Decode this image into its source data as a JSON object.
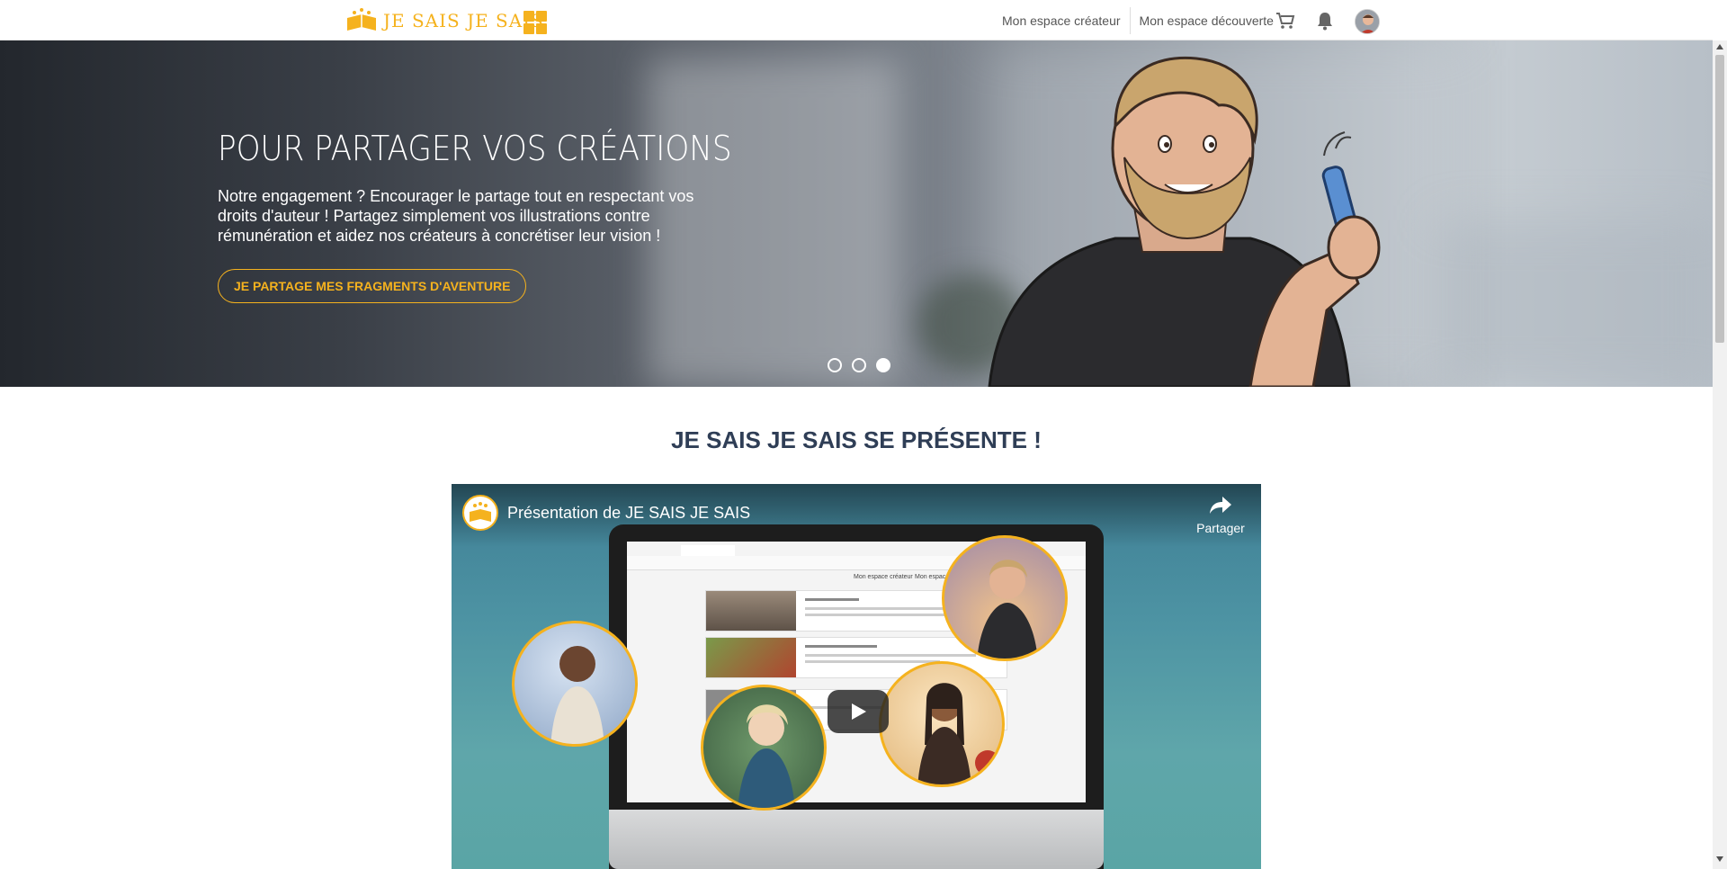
{
  "header": {
    "logo_text": "JE SAIS JE SAIS",
    "apps_icon": "apps-grid-icon",
    "nav": [
      {
        "label": "Mon espace créateur"
      },
      {
        "label": "Mon espace découverte"
      }
    ],
    "icons": [
      "cart-icon",
      "bell-icon",
      "user-avatar"
    ],
    "accent_color": "#f5b21e"
  },
  "hero": {
    "title": "POUR PARTAGER VOS CRÉATIONS",
    "text": "Notre engagement ? Encourager le partage tout en respectant vos droits d'auteur ! Partagez simplement vos illustrations contre rémunération et aidez nos créateurs à concrétiser leur vision !",
    "cta_label": "JE PARTAGE MES FRAGMENTS D'AVENTURE",
    "slides_count": 3,
    "active_slide": 3
  },
  "section": {
    "title": "JE SAIS JE SAIS SE PRÉSENTE !"
  },
  "video": {
    "title": "Présentation de JE SAIS JE SAIS",
    "share_label": "Partager",
    "screen_nav": [
      "Mon espace créateur",
      "Mon espace découverte"
    ]
  }
}
